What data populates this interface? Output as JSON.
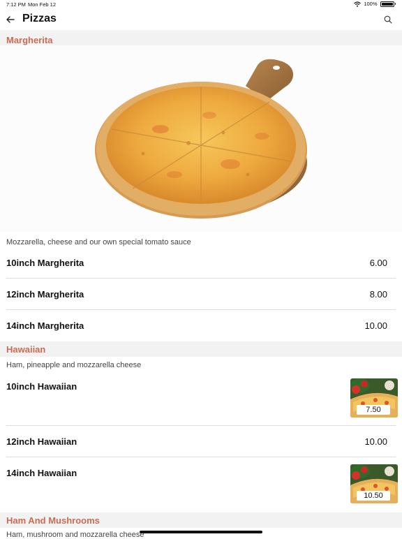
{
  "status_bar": {
    "time": "7:12 PM",
    "date": "Mon Feb 12",
    "battery": "100%"
  },
  "nav": {
    "title": "Pizzas"
  },
  "sections": [
    {
      "title": "Margherita",
      "description": "Mozzarella, cheese and our own special tomato sauce",
      "items": [
        {
          "name": "10inch Margherita",
          "price": "6.00"
        },
        {
          "name": "12inch Margherita",
          "price": "8.00"
        },
        {
          "name": "14inch Margherita",
          "price": "10.00"
        }
      ]
    },
    {
      "title": "Hawaiian",
      "description": "Ham, pineapple and mozzarella cheese",
      "items": [
        {
          "name": "10inch Hawaiian",
          "price": "7.50"
        },
        {
          "name": "12inch Hawaiian",
          "price": "10.00"
        },
        {
          "name": "14inch Hawaiian",
          "price": "10.50"
        }
      ]
    },
    {
      "title": "Ham And Mushrooms",
      "description": "Ham, mushroom and mozzarella cheese"
    }
  ],
  "colors": {
    "section_title": "#cd6b52",
    "section_bg": "#f2f2f2"
  }
}
